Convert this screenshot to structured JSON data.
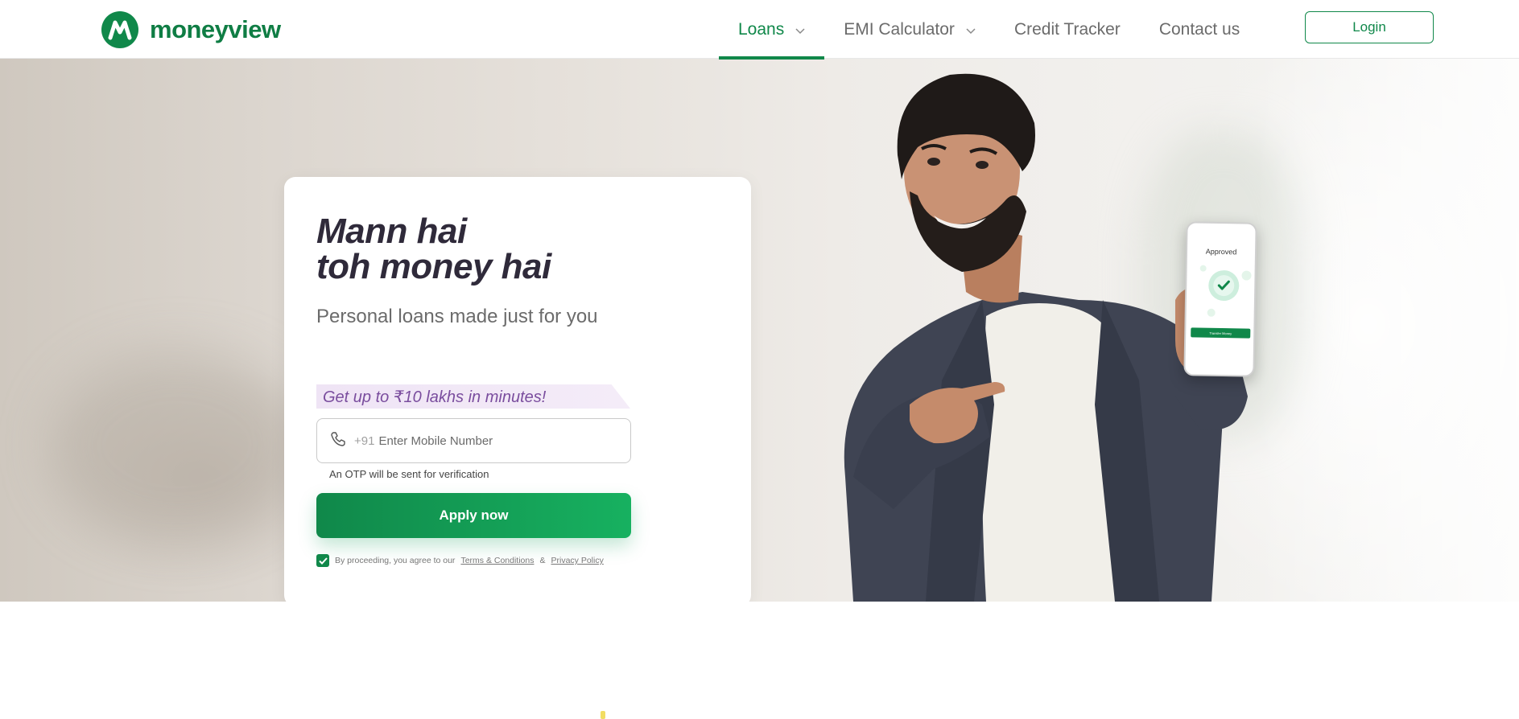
{
  "header": {
    "logo_text": "moneyview",
    "nav": {
      "loans": "Loans",
      "emi_calculator": "EMI Calculator",
      "credit_tracker": "Credit Tracker",
      "contact_us": "Contact us"
    },
    "login_label": "Login"
  },
  "hero": {
    "headline_line1": "Mann hai",
    "headline_line2": "toh money hai",
    "subheadline": "Personal loans made just for you",
    "offer": "Get up to ₹10 lakhs in minutes!",
    "phone_prefix": "+91",
    "phone_placeholder": "Enter Mobile Number",
    "otp_note": "An OTP will be sent for verification",
    "apply_label": "Apply now",
    "consent_text": "By proceeding, you agree to our",
    "terms_link": "Terms & Conditions",
    "consent_and": "&",
    "privacy_link": "Privacy Policy",
    "consent_checked": true
  },
  "phone_mockup": {
    "title": "Approved",
    "button_text": "Transfer Money"
  },
  "colors": {
    "brand_green": "#10884a",
    "offer_purple": "#7a4d9e",
    "headline": "#2f2a3a"
  },
  "icons": {
    "nav_chevron": "chevron-down-icon",
    "phone_field": "phone-icon",
    "checkbox": "check-icon"
  }
}
